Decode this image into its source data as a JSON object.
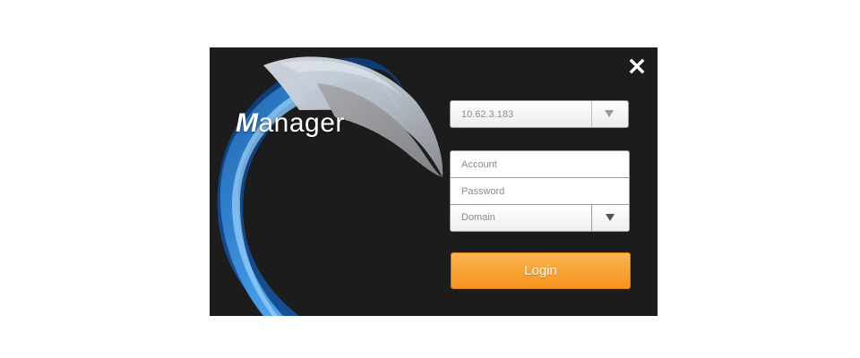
{
  "dialog": {
    "brand": {
      "initial": "M",
      "rest": "anager"
    },
    "close_icon": "close-icon"
  },
  "form": {
    "server": {
      "value": "10.62.3.183",
      "arrow_icon": "triangle-down-icon"
    },
    "account": {
      "placeholder": "Account",
      "value": ""
    },
    "password": {
      "placeholder": "Password",
      "value": ""
    },
    "domain": {
      "value": "Domain",
      "arrow_icon": "triangle-down-icon"
    },
    "login_label": "Login"
  },
  "colors": {
    "background": "#1c1c1c",
    "accent_blue": "#3a8fdd",
    "login_orange": "#f5941f"
  }
}
